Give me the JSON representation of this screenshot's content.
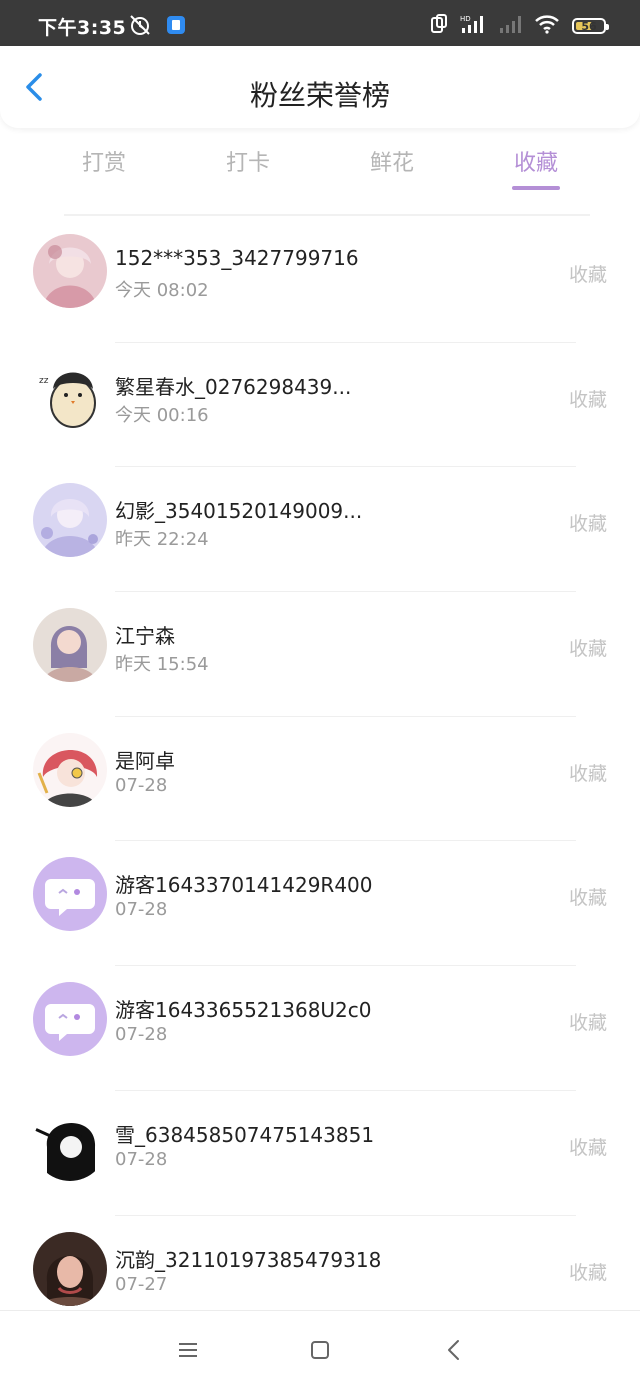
{
  "status_bar": {
    "time": "下午3:35",
    "battery_level": "56",
    "network_label": "HD"
  },
  "header": {
    "title": "粉丝荣誉榜"
  },
  "tabs": [
    {
      "label": "打赏",
      "active": false
    },
    {
      "label": "打卡",
      "active": false
    },
    {
      "label": "鲜花",
      "active": false
    },
    {
      "label": "收藏",
      "active": true
    }
  ],
  "list": [
    {
      "name": "152***353_3427799716",
      "time": "今天 08:02",
      "badge": "收藏",
      "avatar": "pink-anime-avatar"
    },
    {
      "name": "繁星春水_0276298439...",
      "time": "今天 00:16",
      "badge": "收藏",
      "avatar": "penguin-avatar"
    },
    {
      "name": "幻影_35401520149009...",
      "time": "昨天 22:24",
      "badge": "收藏",
      "avatar": "lilac-anime-avatar"
    },
    {
      "name": "江宁森",
      "time": "昨天 15:54",
      "badge": "收藏",
      "avatar": "portrait-avatar"
    },
    {
      "name": "是阿卓",
      "time": "07-28",
      "badge": "收藏",
      "avatar": "redhair-anime-avatar"
    },
    {
      "name": "游客1643370141429R400",
      "time": "07-28",
      "badge": "收藏",
      "avatar": "default-chat-avatar"
    },
    {
      "name": "游客1643365521368U2c0",
      "time": "07-28",
      "badge": "收藏",
      "avatar": "default-chat-avatar"
    },
    {
      "name": "雪_638458507475143851",
      "time": "07-28",
      "badge": "收藏",
      "avatar": "bw-anime-avatar"
    },
    {
      "name": "沉韵_32110197385479318",
      "time": "07-27",
      "badge": "收藏",
      "avatar": "photo-avatar"
    }
  ],
  "colors": {
    "accent": "#b48fd6",
    "back_arrow": "#2a8de8",
    "inactive_tab": "#b5b5b5",
    "badge_text": "#c4c4c4"
  }
}
